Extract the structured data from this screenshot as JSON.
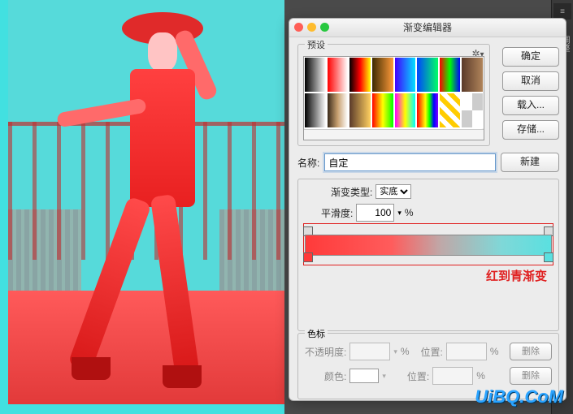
{
  "right_panel": {
    "tab_label": "调整"
  },
  "dialog": {
    "title": "渐变编辑器",
    "presets_label": "预设",
    "buttons": {
      "ok": "确定",
      "cancel": "取消",
      "load": "载入...",
      "save": "存储...",
      "new": "新建"
    },
    "name_label": "名称:",
    "name_value": "自定",
    "type_label": "渐变类型:",
    "type_value": "实底",
    "smooth_label": "平滑度:",
    "smooth_value": "100",
    "smooth_unit": "%",
    "annotation": "红到青渐变",
    "stops_label": "色标",
    "opacity_label": "不透明度:",
    "position_label": "位置:",
    "color_label": "颜色:",
    "percent": "%",
    "delete": "删除"
  },
  "gradient": {
    "start_color": "#ff3a3a",
    "end_color": "#5ae0e0"
  },
  "preset_swatches": [
    "linear-gradient(90deg,#000,#fff)",
    "linear-gradient(90deg,#ff0000,#ffffff)",
    "linear-gradient(90deg,#000,#ff0000,#ffff00)",
    "linear-gradient(90deg,#3d2b00,#ff9a3a)",
    "linear-gradient(90deg,#4200ff,#00e0ff)",
    "linear-gradient(90deg,#0044ff,#00ff66)",
    "linear-gradient(90deg,#ff0000,#00ff00,#0000ff)",
    "linear-gradient(90deg,#5a3a2a,#b0845a)",
    "linear-gradient(90deg,#000,#ffffff00)",
    "linear-gradient(90deg,#3a2a1a,#c8a070,#fff)",
    "linear-gradient(90deg,#5a3a2a,#ffd060)",
    "linear-gradient(90deg,#ff0000,#ffff00,#00ff00)",
    "linear-gradient(90deg,#ff00ff,#ffff00,#00ffff)",
    "linear-gradient(90deg,#ff0000,#ff8000,#ffff00,#00ff00,#0000ff,#8000ff)",
    "repeating-linear-gradient(45deg,#ffcc00 0 6px,#fff 6px 12px)",
    "repeating-conic-gradient(#ccc 0 25%,#fff 0 50%)"
  ],
  "watermark": "UiBQ.CoM"
}
